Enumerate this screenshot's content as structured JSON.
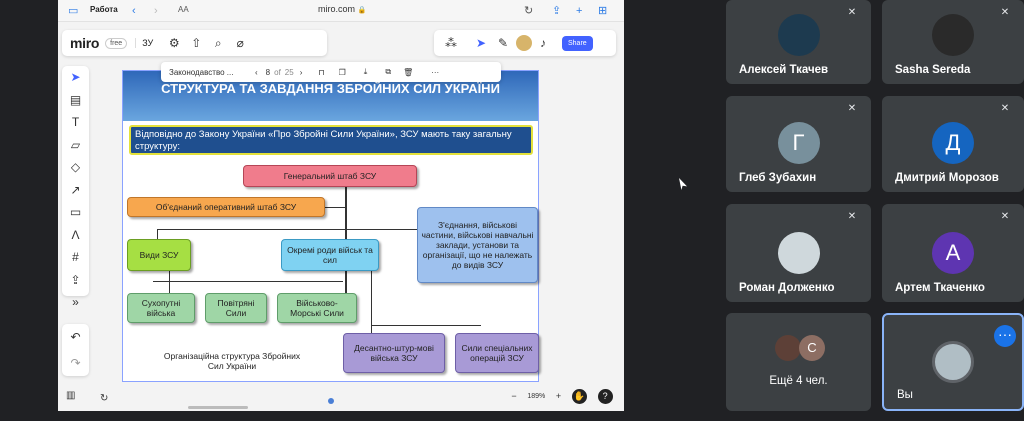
{
  "safari": {
    "tab_group": "Работа",
    "reader_label": "AA",
    "url": "miro.com"
  },
  "miro": {
    "logo": "miro",
    "plan_badge": "free",
    "board_name": "ЗУ",
    "share_label": "Share"
  },
  "context_bar": {
    "doc_name": "Законодавство ...",
    "page_current": "8",
    "page_of": "of",
    "page_total": "25"
  },
  "slide": {
    "title": "СТРУКТУРА ТА ЗАВДАННЯ ЗБРОЙНИХ СИЛ УКРАЇНИ",
    "intro": "Відповідно до Закону України «Про Збройні Сили України», ЗСУ мають таку загальну структуру:",
    "general_staff": "Генеральний штаб ЗСУ",
    "joint_staff": "Об'єднаний оперативний штаб ЗСУ",
    "branches": "Види ЗСУ",
    "separate_arms": "Окремі роди військ та сил",
    "other_units": "З'єднання, військові частини, військові навчальні заклади, установи та організації, що не належать до видів ЗСУ",
    "land_forces": "Сухопутні війська",
    "air_force": "Повітряні Сили",
    "navy": "Військово-Морські Сили",
    "airborne": "Десантно-штур-мові війська ЗСУ",
    "special_ops": "Сили спеціальних операцій ЗСУ",
    "caption": "Організаційна структура Збройних Сил України"
  },
  "zoom": {
    "minus": "−",
    "level": "189%",
    "plus": "+"
  },
  "participants": [
    {
      "name": "Алексей Ткачев",
      "initial": "",
      "color": "#1d3a4f"
    },
    {
      "name": "Sasha Sereda",
      "initial": "",
      "color": "#2a2a2a"
    },
    {
      "name": "Глеб Зубахин",
      "initial": "Г",
      "color": "#78909c"
    },
    {
      "name": "Дмитрий Морозов",
      "initial": "Д",
      "color": "#1565c0"
    },
    {
      "name": "Роман Долженко",
      "initial": "",
      "color": "#cfd8dc"
    },
    {
      "name": "Артем Ткаченко",
      "initial": "А",
      "color": "#5e35b1"
    }
  ],
  "more_tile": {
    "label": "Ещё 4 чел.",
    "initial": "С",
    "color": "#8d6e63"
  },
  "self_tile": {
    "label": "Вы"
  }
}
